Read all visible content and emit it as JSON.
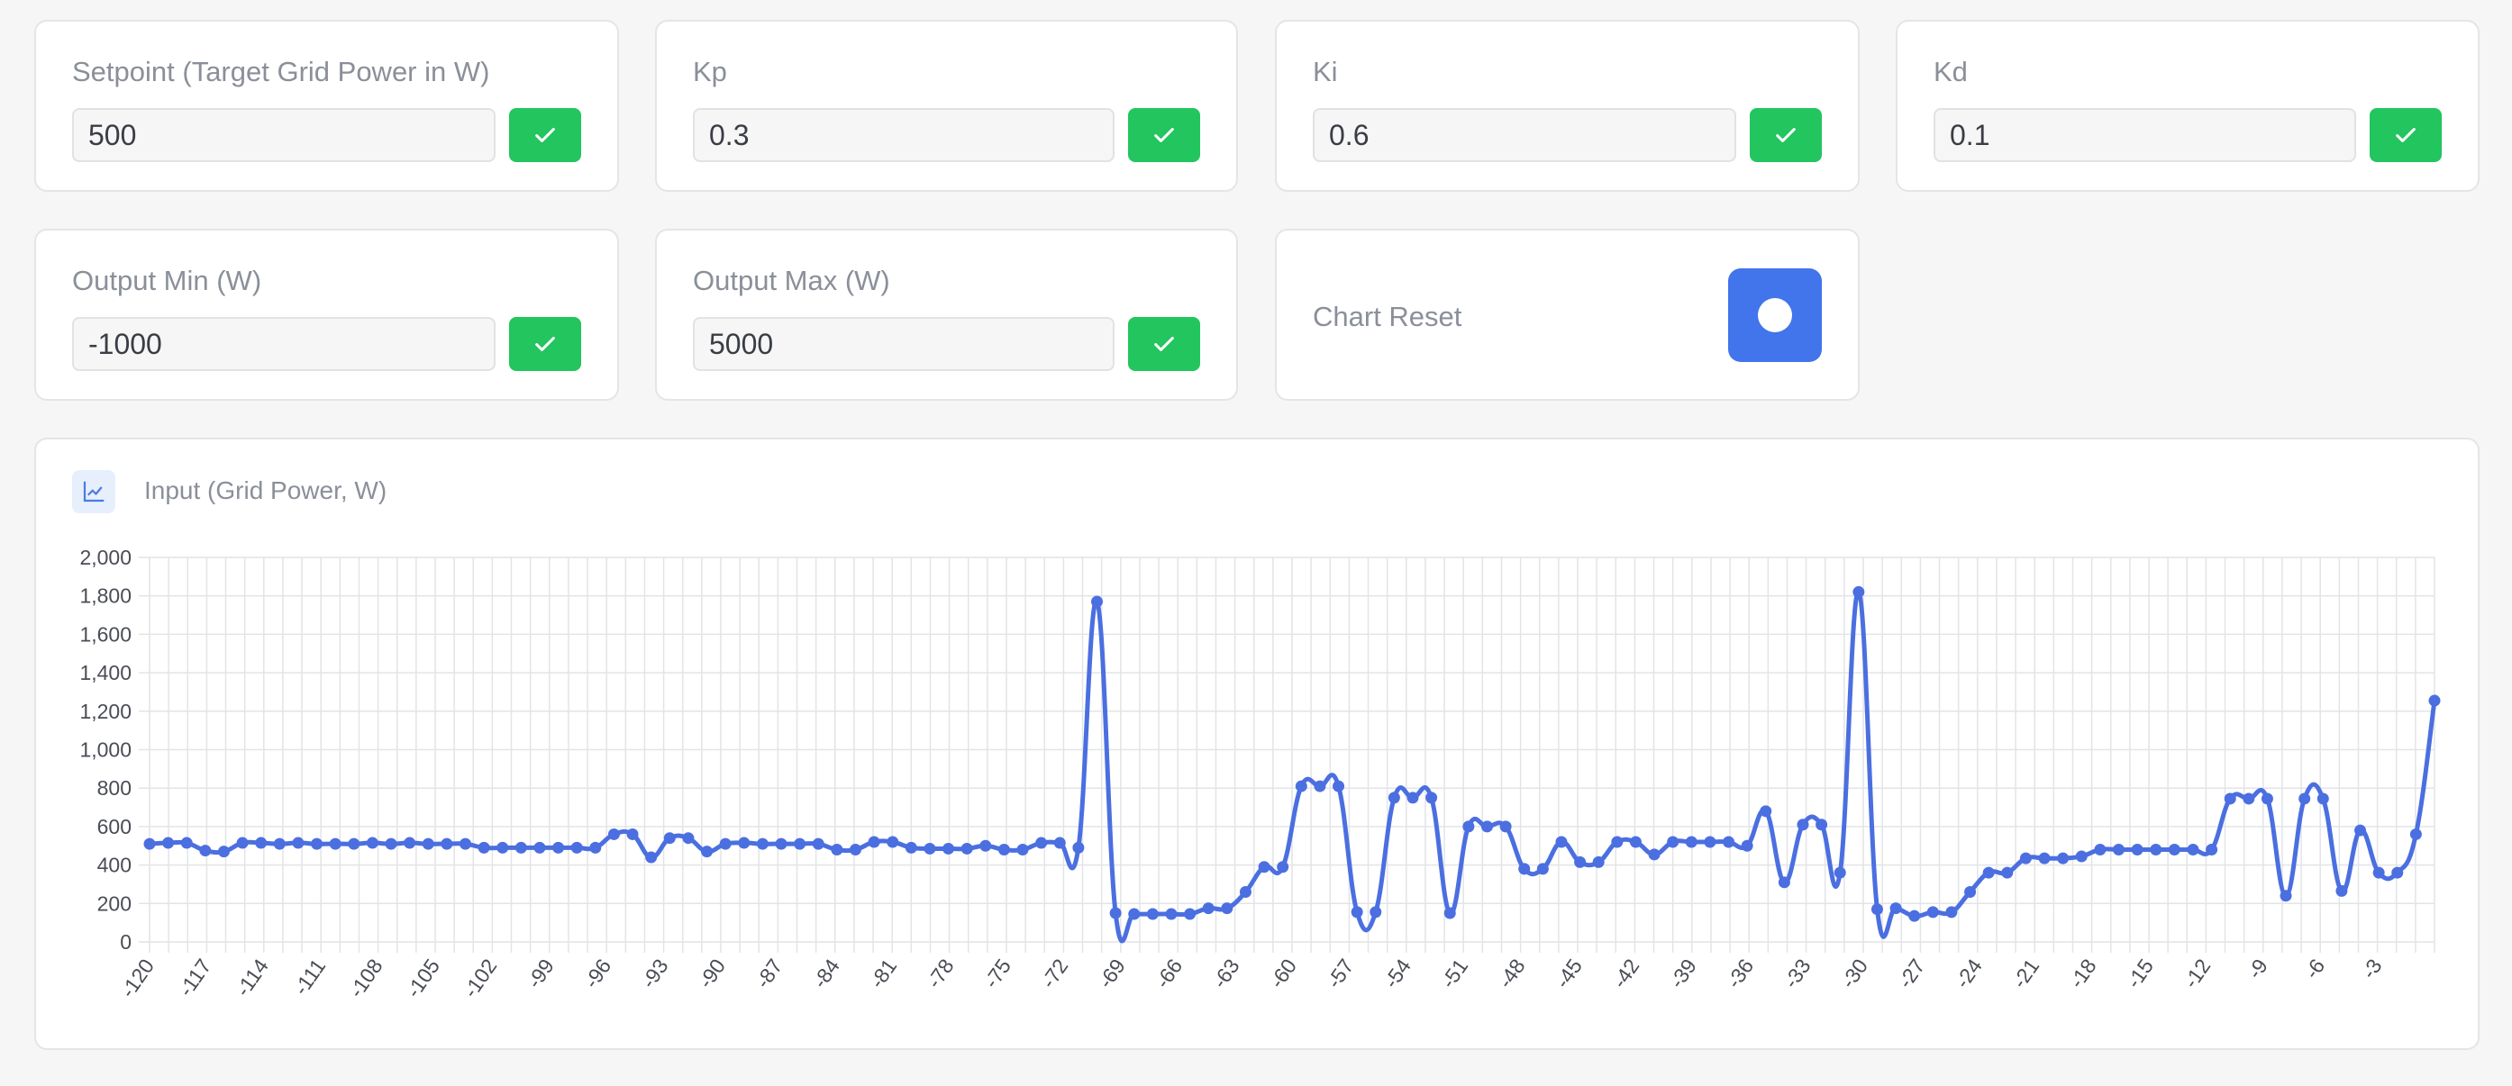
{
  "settings": {
    "setpoint": {
      "label": "Setpoint (Target Grid Power in W)",
      "value": "500"
    },
    "kp": {
      "label": "Kp",
      "value": "0.3"
    },
    "ki": {
      "label": "Ki",
      "value": "0.6"
    },
    "kd": {
      "label": "Kd",
      "value": "0.1"
    },
    "output_min": {
      "label": "Output Min (W)",
      "value": "-1000"
    },
    "output_max": {
      "label": "Output Max (W)",
      "value": "5000"
    }
  },
  "chart_reset": {
    "label": "Chart Reset"
  },
  "icons": {
    "apply": "check-icon",
    "reset": "record-icon",
    "chart": "line-chart-icon"
  },
  "colors": {
    "apply_button": "#22c55e",
    "reset_button": "#4274eb",
    "series_line": "#4b6fe0"
  },
  "chart_data": {
    "type": "line",
    "title": "Input (Grid Power, W)",
    "xlabel": "",
    "ylabel": "",
    "x_start": -120,
    "x_end": 0,
    "x_tick_labels": [
      "-120",
      "-117",
      "-114",
      "-111",
      "-108",
      "-105",
      "-102",
      "-99",
      "-96",
      "-93",
      "-90",
      "-87",
      "-84",
      "-81",
      "-78",
      "-75",
      "-72",
      "-69",
      "-66",
      "-63",
      "-60",
      "-57",
      "-54",
      "-51",
      "-48",
      "-45",
      "-42",
      "-39",
      "-36",
      "-33",
      "-30",
      "-27",
      "-24",
      "-21",
      "-18",
      "-15",
      "-12",
      "-9",
      "-6",
      "-3"
    ],
    "y_tick_labels": [
      "0",
      "200",
      "400",
      "600",
      "800",
      "1,000",
      "1,200",
      "1,400",
      "1,600",
      "1,800",
      "2,000"
    ],
    "ylim": [
      0,
      2000
    ],
    "grid": true,
    "series": [
      {
        "values": [
          510,
          515,
          515,
          475,
          470,
          515,
          515,
          510,
          515,
          510,
          510,
          510,
          515,
          510,
          515,
          510,
          510,
          510,
          490,
          490,
          490,
          490,
          490,
          490,
          490,
          560,
          560,
          440,
          540,
          540,
          470,
          510,
          515,
          510,
          510,
          510,
          510,
          480,
          480,
          520,
          520,
          490,
          485,
          485,
          485,
          500,
          480,
          480,
          515,
          515,
          490,
          1770,
          150,
          145,
          145,
          145,
          145,
          175,
          175,
          260,
          390,
          390,
          810,
          810,
          810,
          155,
          155,
          750,
          750,
          750,
          150,
          600,
          600,
          600,
          380,
          380,
          520,
          415,
          415,
          520,
          520,
          455,
          520,
          520,
          520,
          520,
          500,
          680,
          310,
          610,
          610,
          360,
          1820,
          170,
          175,
          135,
          155,
          155,
          260,
          360,
          360,
          435,
          435,
          435,
          445,
          480,
          480,
          480,
          480,
          480,
          480,
          480,
          745,
          745,
          745,
          240,
          745,
          745,
          265,
          580,
          360,
          360,
          560,
          1255
        ]
      }
    ]
  }
}
